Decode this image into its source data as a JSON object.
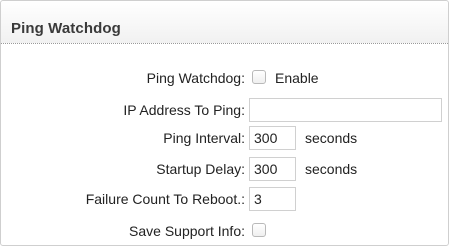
{
  "panel": {
    "title": "Ping Watchdog"
  },
  "fields": {
    "ping_watchdog": {
      "label": "Ping Watchdog:",
      "option": "Enable",
      "checked": false
    },
    "ip_address": {
      "label": "IP Address To Ping:",
      "value": ""
    },
    "ping_interval": {
      "label": "Ping Interval:",
      "value": "300",
      "unit": "seconds"
    },
    "startup_delay": {
      "label": "Startup Delay:",
      "value": "300",
      "unit": "seconds"
    },
    "failure_count": {
      "label": "Failure Count To Reboot.:",
      "value": "3"
    },
    "save_support": {
      "label": "Save Support Info:",
      "checked": false
    }
  }
}
